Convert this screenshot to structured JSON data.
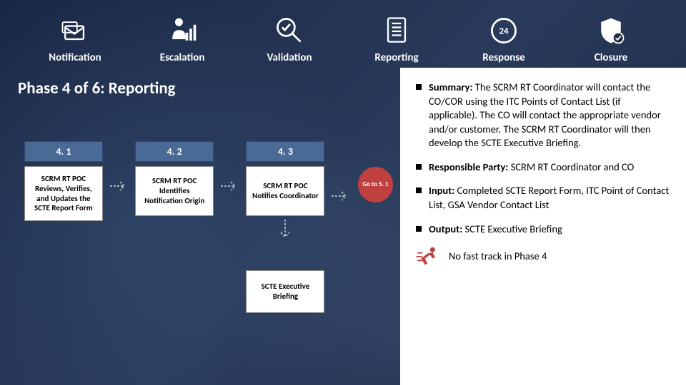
{
  "steps": [
    {
      "label": "Notification"
    },
    {
      "label": "Escalation"
    },
    {
      "label": "Validation"
    },
    {
      "label": "Reporting"
    },
    {
      "label": "Response"
    },
    {
      "label": "Closure"
    }
  ],
  "phase_title": "Phase 4 of 6:  Reporting",
  "flow": {
    "s1_num": "4. 1",
    "s1_box": "SCRM RT POC Reviews, Verifies, and Updates the SCTE Report Form",
    "s2_num": "4. 2",
    "s2_box": "SCRM RT POC Identifies Notification Origin",
    "s3_num": "4. 3",
    "s3_box": "SCRM RT POC Notifies Coordinator",
    "s3_box2": "SCTE Executive Briefing",
    "goto": "Go to 5. 1"
  },
  "bullets": {
    "b1_label": "Summary:",
    "b1_text": "  The SCRM RT Coordinator will contact the CO/COR using the ITC Points of Contact List (if applicable).  The CO will contact the appropriate vendor and/or customer.  The SCRM RT Coordinator will then develop the SCTE Executive Briefing.",
    "b2_label": "Responsible Party:",
    "b2_text": "  SCRM RT Coordinator and CO",
    "b3_label": "Input:",
    "b3_text": "  Completed SCTE Report Form, ITC Point of Contact List, GSA Vendor Contact List",
    "b4_label": "Output:",
    "b4_text": "  SCTE Executive Briefing"
  },
  "fasttrack": "No fast track in Phase 4"
}
